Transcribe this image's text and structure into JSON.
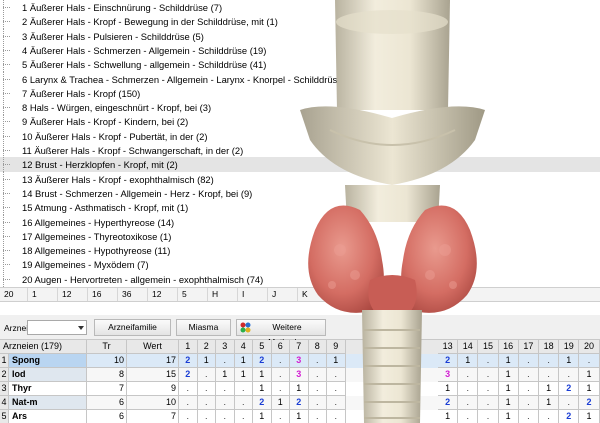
{
  "rubrics": [
    {
      "n": "1",
      "text": "Äußerer Hals - Einschnürung - Schilddrüse (7)"
    },
    {
      "n": "2",
      "text": "Äußerer Hals - Kropf - Bewegung in der Schilddrüse, mit (1)"
    },
    {
      "n": "3",
      "text": "Äußerer Hals - Pulsieren - Schilddrüse (5)"
    },
    {
      "n": "4",
      "text": "Äußerer Hals - Schmerzen - Allgemein - Schilddrüse (19)"
    },
    {
      "n": "5",
      "text": "Äußerer Hals - Schwellung - allgemein - Schilddrüse (41)"
    },
    {
      "n": "6",
      "text": "Larynx & Trachea - Schmerzen - Allgemein - Larynx - Knorpel - Schilddrüse (7)"
    },
    {
      "n": "7",
      "text": "Äußerer Hals - Kropf (150)"
    },
    {
      "n": "8",
      "text": "Hals - Würgen, eingeschnürt - Kropf, bei (3)"
    },
    {
      "n": "9",
      "text": "Äußerer Hals - Kropf - Kindern, bei (2)"
    },
    {
      "n": "10",
      "text": "Äußerer Hals - Kropf - Pubertät, in der (2)"
    },
    {
      "n": "11",
      "text": "Äußerer Hals - Kropf - Schwangerschaft, in der (2)"
    },
    {
      "n": "12",
      "text": "Brust - Herzklopfen - Kropf, mit (2)"
    },
    {
      "n": "13",
      "text": "Äußerer Hals - Kropf - exophthalmisch (82)"
    },
    {
      "n": "14",
      "text": "Brust - Schmerzen - Allgemein - Herz - Kropf, bei (9)"
    },
    {
      "n": "15",
      "text": "Atmung - Asthmatisch - Kropf, mit (1)"
    },
    {
      "n": "16",
      "text": "Allgemeines - Hyperthyreose (14)"
    },
    {
      "n": "17",
      "text": "Allgemeines - Thyreotoxikose (1)"
    },
    {
      "n": "18",
      "text": "Allgemeines - Hypothyreose (11)"
    },
    {
      "n": "19",
      "text": "Allgemeines - Myxödem (7)"
    },
    {
      "n": "20",
      "text": "Augen - Hervortreten - allgemein - exophthalmisch (74)"
    }
  ],
  "selected_rubric": 11,
  "num_strip": [
    "20",
    "1",
    "12",
    "16",
    "36",
    "12",
    "5",
    "H",
    "I",
    "J",
    "K"
  ],
  "toolbar": {
    "remedy_label": "Arznei",
    "family_button": "Arzneifamilie",
    "miasm_button": "Miasma",
    "more_methods_button": "Weitere Methoden"
  },
  "grid": {
    "header": {
      "remedies": "Arzneien (179)",
      "tr": "Tr",
      "wert": "Wert",
      "cols_left": [
        "1",
        "2",
        "3",
        "4",
        "5",
        "6",
        "7",
        "8",
        "9"
      ],
      "cols_right": [
        "13",
        "14",
        "15",
        "16",
        "17",
        "18",
        "19",
        "20"
      ]
    },
    "rows": [
      {
        "n": "1",
        "name": "Spong",
        "tr": "10",
        "wert": "17",
        "left": [
          "2",
          "1",
          ".",
          "1",
          "2",
          ".",
          "3",
          ".",
          "1"
        ],
        "right": [
          "2",
          "1",
          ".",
          "1",
          ".",
          ".",
          "1",
          "."
        ]
      },
      {
        "n": "2",
        "name": "Iod",
        "tr": "8",
        "wert": "15",
        "left": [
          "2",
          ".",
          "1",
          "1",
          "1",
          ".",
          "3",
          ".",
          "."
        ],
        "right": [
          "3",
          ".",
          ".",
          "1",
          ".",
          ".",
          ".",
          "1"
        ]
      },
      {
        "n": "3",
        "name": "Thyr",
        "tr": "7",
        "wert": "9",
        "left": [
          ".",
          ".",
          ".",
          ".",
          "1",
          ".",
          "1",
          ".",
          "."
        ],
        "right": [
          "1",
          ".",
          ".",
          "1",
          ".",
          "1",
          "2",
          "1"
        ]
      },
      {
        "n": "4",
        "name": "Nat-m",
        "tr": "6",
        "wert": "10",
        "left": [
          ".",
          ".",
          ".",
          ".",
          "2",
          "1",
          "2",
          ".",
          "."
        ],
        "right": [
          "2",
          ".",
          ".",
          "1",
          ".",
          "1",
          ".",
          "2"
        ]
      },
      {
        "n": "5",
        "name": "Ars",
        "tr": "6",
        "wert": "7",
        "left": [
          ".",
          ".",
          ".",
          ".",
          "1",
          ".",
          "1",
          ".",
          "."
        ],
        "right": [
          "1",
          ".",
          ".",
          "1",
          ".",
          ".",
          "2",
          "1"
        ]
      }
    ]
  },
  "colors": {
    "value_1": "#000000",
    "value_2": "#1a3dd4",
    "value_3": "#d21fd2",
    "selected_row": "#e4e4e4",
    "remedy_highlight": "#b9d5f1",
    "thyroid": "#d9786f",
    "cartilage": "#e8e2cf"
  }
}
